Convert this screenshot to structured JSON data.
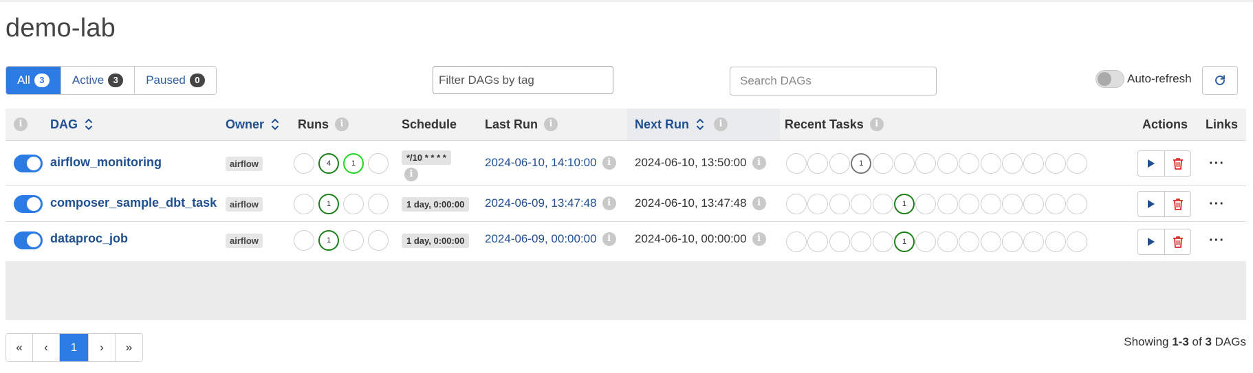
{
  "page": {
    "title": "demo-lab"
  },
  "status_filter": [
    {
      "label": "All",
      "count": "3",
      "active": true
    },
    {
      "label": "Active",
      "count": "3",
      "active": false
    },
    {
      "label": "Paused",
      "count": "0",
      "active": false
    }
  ],
  "tag_filter": {
    "placeholder": "Filter DAGs by tag"
  },
  "search": {
    "placeholder": "Search DAGs"
  },
  "auto_refresh": {
    "label": "Auto-refresh",
    "enabled": false
  },
  "table": {
    "headers": {
      "dag": "DAG",
      "owner": "Owner",
      "runs": "Runs",
      "schedule": "Schedule",
      "last_run": "Last Run",
      "next_run": "Next Run",
      "recent_tasks": "Recent Tasks",
      "actions": "Actions",
      "links": "Links"
    },
    "rows": [
      {
        "dag_id": "airflow_monitoring",
        "paused": false,
        "owner": "airflow",
        "runs": [
          "",
          "4",
          "1",
          ""
        ],
        "schedule": "*/10 * * * *",
        "last_run": "2024-06-10, 14:10:00",
        "next_run": "2024-06-10, 13:50:00",
        "recent_tasks_count": "1"
      },
      {
        "dag_id": "composer_sample_dbt_task",
        "paused": false,
        "owner": "airflow",
        "runs": [
          "",
          "1",
          "",
          ""
        ],
        "schedule": "1 day, 0:00:00",
        "last_run": "2024-06-09, 13:47:48",
        "next_run": "2024-06-10, 13:47:48",
        "recent_tasks_count": "1"
      },
      {
        "dag_id": "dataproc_job",
        "paused": false,
        "owner": "airflow",
        "runs": [
          "",
          "1",
          "",
          ""
        ],
        "schedule": "1 day, 0:00:00",
        "last_run": "2024-06-09, 00:00:00",
        "next_run": "2024-06-10, 00:00:00",
        "recent_tasks_count": "1"
      }
    ]
  },
  "pagination": {
    "first": "«",
    "prev": "‹",
    "current": "1",
    "next": "›",
    "last": "»"
  },
  "footer": {
    "showing_prefix": "Showing",
    "range": "1-3",
    "of": "of",
    "total": "3",
    "suffix": "DAGs"
  },
  "colors": {
    "primary": "#2c7be5",
    "link": "#1f4f8f",
    "success_dark": "#198019",
    "running": "#21d421",
    "delete": "#e02424"
  }
}
